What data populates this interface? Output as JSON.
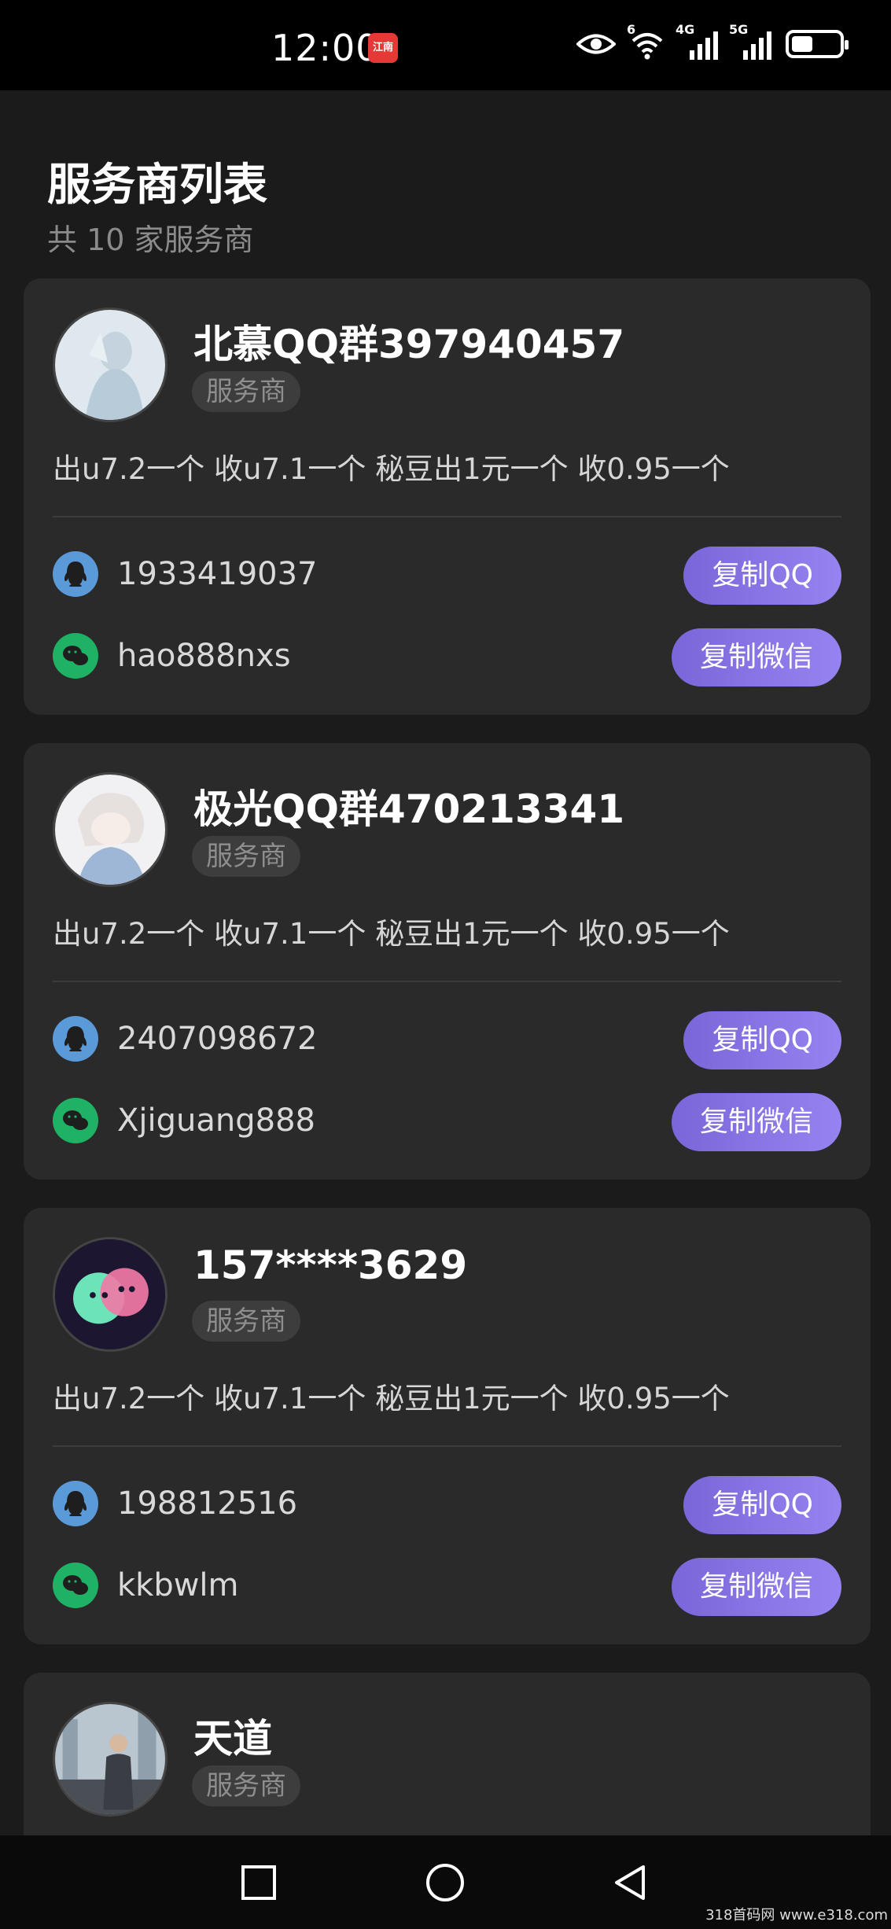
{
  "status_bar": {
    "time": "12:00",
    "app_badge": "江南",
    "net1": "6",
    "net2": "4G",
    "net3": "5G"
  },
  "header": {
    "title": "服务商列表",
    "subtitle": "共 10 家服务商"
  },
  "cards": [
    {
      "name": "北慕QQ群397940457",
      "role": "服务商",
      "desc": "出u7.2一个 收u7.1一个 秘豆出1元一个 收0.95一个",
      "qq": "1933419037",
      "wechat": "hao888nxs",
      "copy_qq": "复制QQ",
      "copy_wechat": "复制微信"
    },
    {
      "name": "极光QQ群470213341",
      "role": "服务商",
      "desc": "出u7.2一个 收u7.1一个 秘豆出1元一个 收0.95一个",
      "qq": "2407098672",
      "wechat": "Xjiguang888",
      "copy_qq": "复制QQ",
      "copy_wechat": "复制微信"
    },
    {
      "name": "157****3629",
      "role": "服务商",
      "desc": "出u7.2一个 收u7.1一个 秘豆出1元一个 收0.95一个",
      "qq": "198812516",
      "wechat": "kkbwlm",
      "copy_qq": "复制QQ",
      "copy_wechat": "复制微信"
    },
    {
      "name": "天道",
      "role": "服务商"
    }
  ],
  "watermark": "318首码网 www.e318.com",
  "colors": {
    "accent_start": "#7b66d9",
    "accent_end": "#9683f0",
    "qq_icon": "#5b9ad8",
    "wechat_icon": "#1fb164",
    "card_bg": "#2a2a2a",
    "page_bg": "#1b1b1b"
  }
}
